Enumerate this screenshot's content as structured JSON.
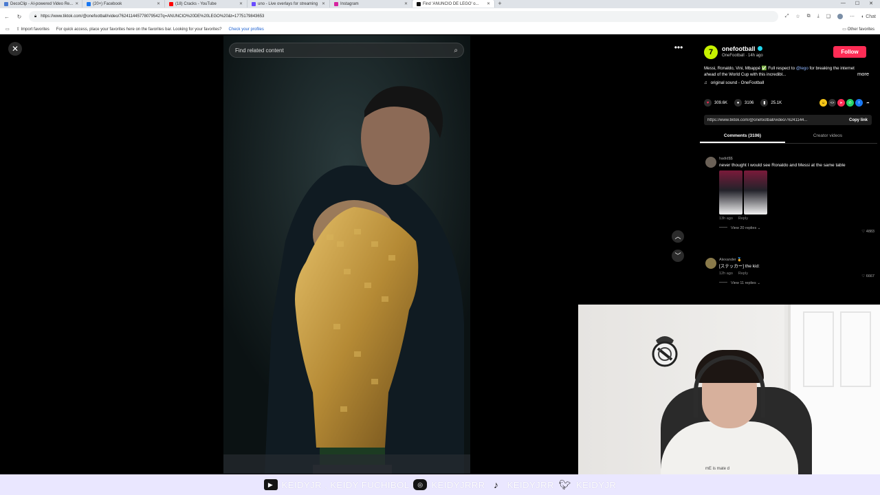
{
  "browser": {
    "tabs": [
      {
        "title": "DecoClip - AI-powered Video Re...",
        "color": "#4a7bd1",
        "active": false
      },
      {
        "title": "(20+) Facebook",
        "color": "#1877f2",
        "active": false
      },
      {
        "title": "(18) Cracks - YouTube",
        "color": "#ff0000",
        "active": false
      },
      {
        "title": "uno - Live overlays for streaming",
        "color": "#6a4cff",
        "active": false
      },
      {
        "title": "Instagram",
        "color": "#d6249f",
        "active": false
      },
      {
        "title": "Find 'ANUNCIO DE LEGO' o...",
        "color": "#111111",
        "active": true
      }
    ],
    "url": "https://www.tiktok.com/@onefootball/video/7624114457780795427q=ANUNCIO%20DE%20LEGO%20&t=1775179843653",
    "favorites_bar": {
      "import": "Import favorites",
      "message": "For quick access, place your favorites here on the favorites bar. Looking for your favorites?",
      "link": "Check your profiles",
      "other": "Other favorites"
    },
    "chat_label": "Chat"
  },
  "video": {
    "search_placeholder": "Find related content"
  },
  "post": {
    "avatar_letter": "7",
    "username": "onefootball",
    "subtitle": "OneFootball · 14h ago",
    "follow_label": "Follow",
    "description_pre": "Messi, Ronaldo, Vini, Mbappé ✅ Full respect to ",
    "description_tag": "@lego",
    "description_post": " for breaking the internet ahead of the World Cup with this incredibl...",
    "more_label": "more",
    "sound": "original sound - OneFootball",
    "likes": "309.6K",
    "comments": "3106",
    "saves": "25.1K",
    "link_url": "https://www.tiktok.com/@onefootball/video/76241144...",
    "copy_link_label": "Copy link",
    "tab_comments": "Comments (3106)",
    "tab_creator": "Creator videos"
  },
  "comments": [
    {
      "user": "hadid$$",
      "text": "never thought I would see Ronaldo and Messi at the same table",
      "time": "13h ago",
      "reply": "Reply",
      "likes": "♡ 4883",
      "replies": "View 20 replies ⌄"
    },
    {
      "user": "Alexander 🏅",
      "text": "[ステッカー] the kid:",
      "time": "12h ago",
      "reply": "Reply",
      "likes": "♡ 6667",
      "replies": "View 11 replies ⌄"
    }
  ],
  "webcam": {
    "shirt_text": "mE is mate d"
  },
  "banner": {
    "youtube": "KEIDYJR , KEIDY FUCHIBOL",
    "instagram": "KEIDYJRRR",
    "tiktok": "KEIDYJRR",
    "twitter": "KEIDYJR"
  },
  "colors": {
    "accent_follow": "#fe2c55",
    "banner_bg": "#eae7ff"
  }
}
